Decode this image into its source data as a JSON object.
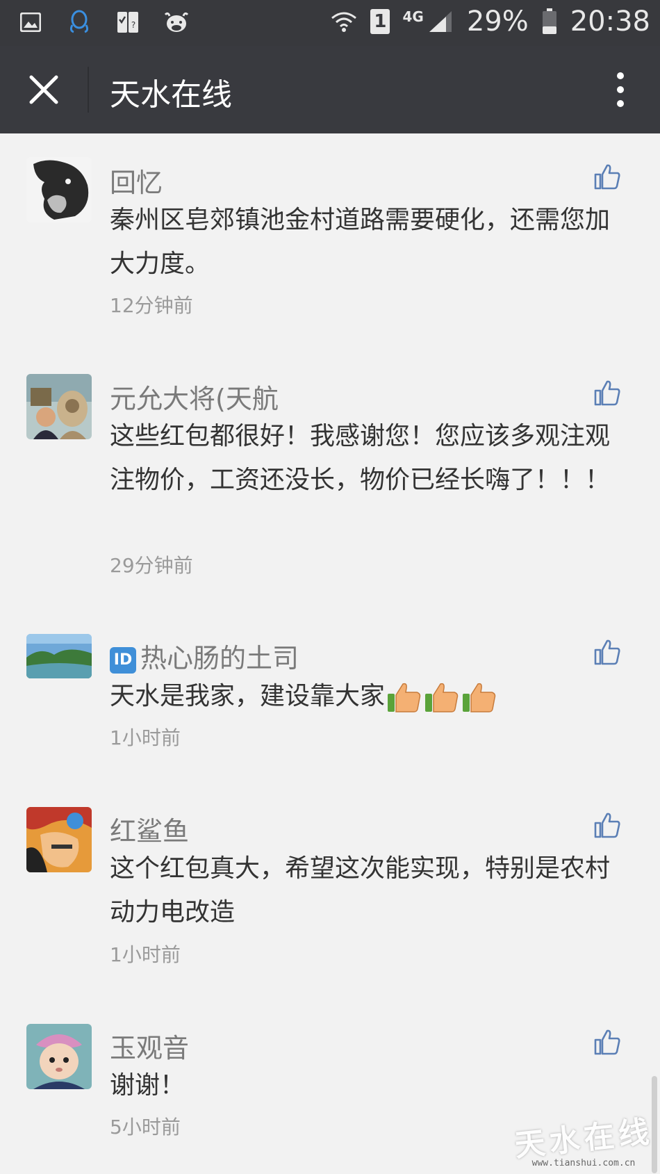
{
  "status_bar": {
    "carrier_badge": "1",
    "network_type": "4G",
    "battery": "29%",
    "time": "20:38",
    "icons": [
      "gallery-icon",
      "qq-icon",
      "sim-tool-icon",
      "cow-icon",
      "wifi-icon",
      "signal-icon",
      "battery-icon"
    ]
  },
  "navbar": {
    "title": "天水在线",
    "icons": [
      "close-icon",
      "more-vertical-icon"
    ]
  },
  "comments": [
    {
      "name": "回忆",
      "text": "秦州区皂郊镇池金村道路需要硬化，还需您加大力度。",
      "time": "12分钟前"
    },
    {
      "name": "元允大将(天航",
      "text": "这些红包都很好！我感谢您！您应该多观注观注物价，工资还没长，物价已经长嗨了！！！",
      "time": "29分钟前"
    },
    {
      "name": "热心肠的土司",
      "badge": "ID",
      "text": "天水是我家，建设靠大家",
      "emoji_count": 3,
      "time": "1小时前"
    },
    {
      "name": "红鲨鱼",
      "text": "这个红包真大，希望这次能实现，特别是农村动力电改造",
      "time": "1小时前"
    },
    {
      "name": "玉观音",
      "text": "谢谢！",
      "time": "5小时前"
    }
  ],
  "watermark": {
    "logo_text": "天水在线",
    "url": "www.tianshui.com.cn"
  },
  "colors": {
    "status_bar": "#38393d",
    "navbar": "#393a3f",
    "background": "#f2f2f2",
    "like_icon": "#5b7fb5"
  }
}
